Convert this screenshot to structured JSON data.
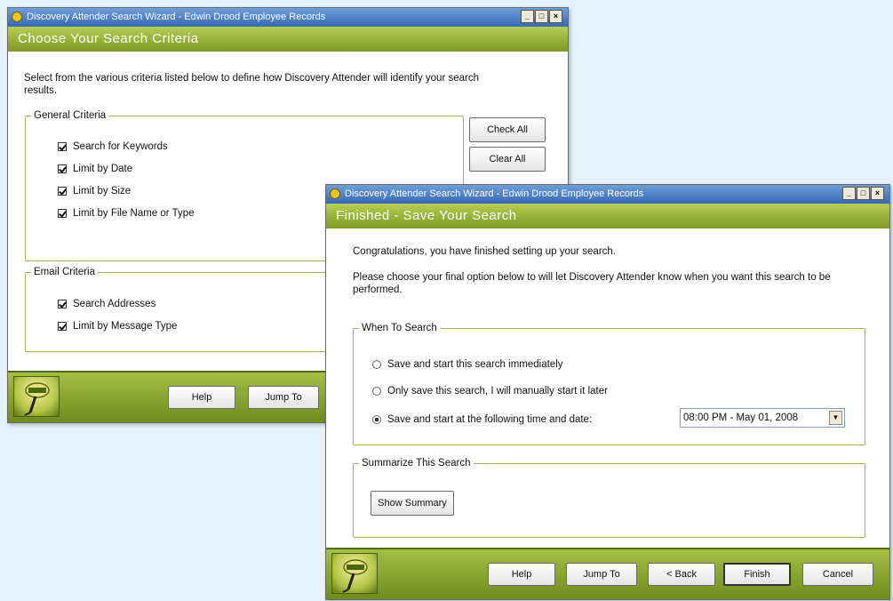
{
  "window1": {
    "title": "Discovery Attender Search Wizard - Edwin Drood Employee Records",
    "header": "Choose Your Search Criteria",
    "intro": "Select from the various criteria listed below to define how Discovery Attender will identify your search results.",
    "general_legend": "General Criteria",
    "general_items": [
      "Search for Keywords",
      "Limit by Date",
      "Limit by Size",
      "Limit by File Name or Type"
    ],
    "email_legend": "Email Criteria",
    "email_items": [
      "Search Addresses",
      "Limit by Message Type"
    ],
    "check_all": "Check All",
    "clear_all": "Clear All",
    "help": "Help",
    "jump_to": "Jump To"
  },
  "window2": {
    "title": "Discovery Attender Search Wizard - Edwin Drood Employee Records",
    "header": "Finished - Save Your Search",
    "congrats": "Congratulations, you have finished setting up your search.",
    "instruction": "Please choose your final option below to will let Discovery Attender know when you want this search to be performed.",
    "when_legend": "When To Search",
    "options": [
      "Save and start this search immediately",
      "Only save this search, I will manually start it later",
      "Save and start at the following time and date:"
    ],
    "selected_option": 2,
    "datetime": "08:00 PM - May 01, 2008",
    "summary_legend": "Summarize This Search",
    "show_summary": "Show Summary",
    "help": "Help",
    "jump_to": "Jump To",
    "back": "< Back",
    "finish": "Finish",
    "cancel": "Cancel"
  },
  "window_controls": {
    "minimize": "_",
    "maximize": "□",
    "close": "×"
  },
  "colors": {
    "page_bg": "#e6f2fb",
    "header_green": "#8ea92e",
    "titlebar_blue": "#3668b4"
  },
  "icons": {
    "app": "discovery-attender-icon",
    "logo": "discovery-attender-logo"
  }
}
